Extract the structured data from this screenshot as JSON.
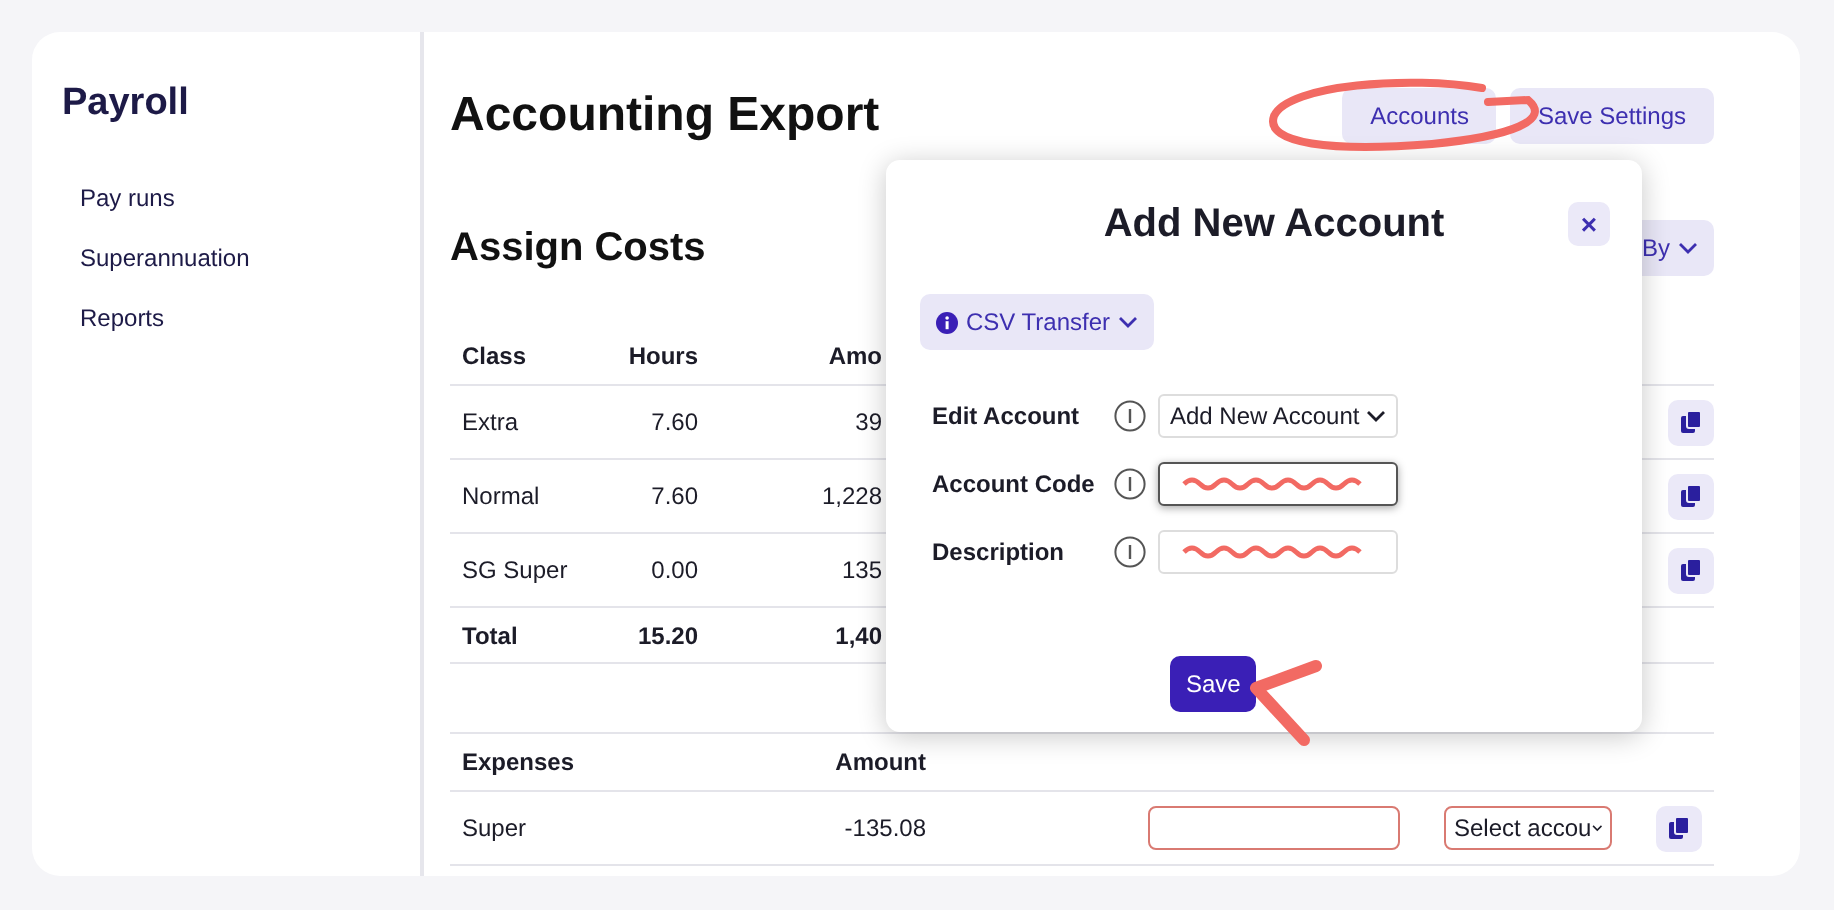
{
  "sidebar": {
    "title": "Payroll",
    "items": [
      {
        "label": "Pay runs"
      },
      {
        "label": "Superannuation"
      },
      {
        "label": "Reports"
      }
    ]
  },
  "page": {
    "title": "Accounting Export",
    "buttons": [
      "Accounts",
      "Save Settings"
    ]
  },
  "section": {
    "title": "Assign Costs",
    "group_button": "By"
  },
  "classes_table": {
    "columns": [
      "Class",
      "Hours",
      "Amo"
    ],
    "rows": [
      {
        "kind": "item",
        "cells": [
          "Extra",
          "7.60",
          "39"
        ]
      },
      {
        "kind": "item",
        "cells": [
          "Normal",
          "7.60",
          "1,228"
        ]
      },
      {
        "kind": "item",
        "cells": [
          "SG Super",
          "0.00",
          "135"
        ]
      },
      {
        "kind": "total",
        "cells": [
          "Total",
          "15.20",
          "1,40"
        ]
      }
    ]
  },
  "expenses_table": {
    "columns": [
      "Expenses",
      "Amount"
    ],
    "rows": [
      {
        "kind": "item",
        "cells": [
          "Super",
          "-135.08"
        ],
        "account_field": {
          "invalid": true
        },
        "account_select": {
          "value": "Select accou",
          "invalid": true
        }
      }
    ]
  },
  "modal": {
    "title": "Add New Account",
    "close": "×",
    "transfer_button": "CSV Transfer",
    "fields": [
      {
        "kind": "select",
        "label": "Edit Account",
        "value": "Add New Account"
      },
      {
        "kind": "input",
        "label": "Account Code",
        "focused": true
      },
      {
        "kind": "input",
        "label": "Description",
        "focused": false
      }
    ],
    "save": "Save"
  }
}
